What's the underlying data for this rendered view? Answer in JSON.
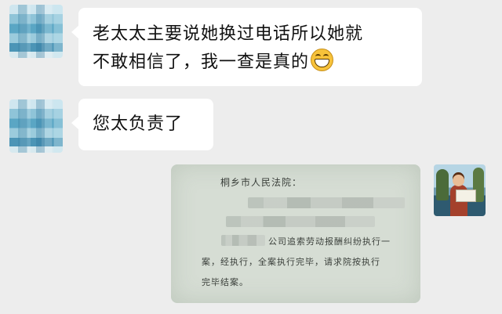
{
  "messages": [
    {
      "sender": "left",
      "lines": [
        "老太太主要说她换过电话所以她就",
        "不敢相信了，我一查是真的"
      ],
      "trailing_emoji": "grin-icon"
    },
    {
      "sender": "left",
      "text": "您太负责了"
    },
    {
      "sender": "right",
      "type": "image",
      "document": {
        "heading": "桐乡市人民法院：",
        "line1": "公司追索劳动报酬纠纷执行一",
        "line2": "案，经执行，全案执行完毕，请求院按执行",
        "line3": "完毕结案。"
      }
    }
  ],
  "colors": {
    "background": "#ededed",
    "bubble_left": "#ffffff"
  }
}
